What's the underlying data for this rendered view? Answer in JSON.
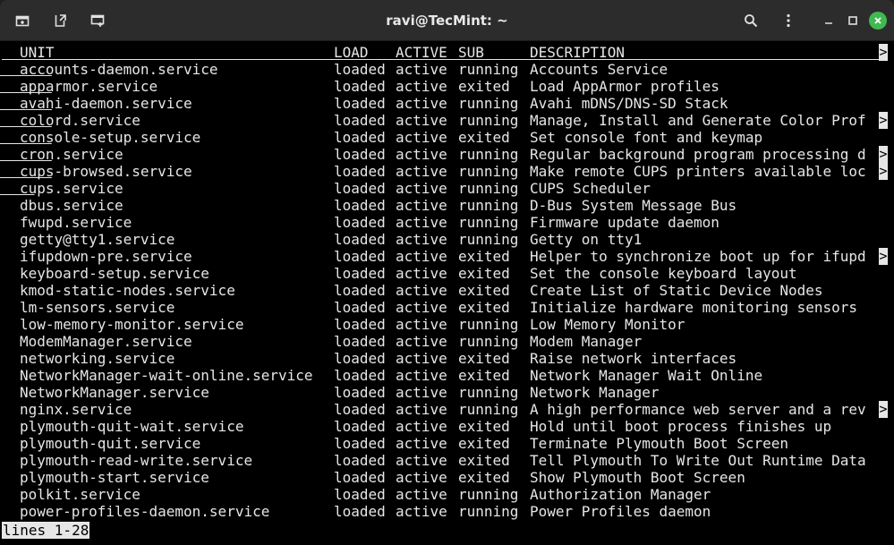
{
  "window": {
    "title": "ravi@TecMint: ~"
  },
  "icons": {
    "new_tab": "new-tab-icon",
    "detach_tab": "detach-tab-icon",
    "new_window": "new-window-icon",
    "search": "search-icon",
    "menu": "kebab-menu-icon",
    "minimize": "minimize-icon",
    "maximize": "maximize-icon",
    "close": "close-icon"
  },
  "colors": {
    "titlebar": "#2c2c2c",
    "terminal_bg": "#000000",
    "terminal_fg": "#e6e6e6",
    "close_button": "#3fb950"
  },
  "table": {
    "headers": {
      "unit": "UNIT",
      "load": "LOAD",
      "active": "ACTIVE",
      "sub": "SUB",
      "description": "DESCRIPTION"
    },
    "truncation_marker": ">",
    "rows": [
      {
        "unit": "accounts-daemon.service",
        "load": "loaded",
        "active": "active",
        "sub": "running",
        "description": "Accounts Service",
        "truncated": false
      },
      {
        "unit": "apparmor.service",
        "load": "loaded",
        "active": "active",
        "sub": "exited",
        "description": "Load AppArmor profiles",
        "truncated": false
      },
      {
        "unit": "avahi-daemon.service",
        "load": "loaded",
        "active": "active",
        "sub": "running",
        "description": "Avahi mDNS/DNS-SD Stack",
        "truncated": false
      },
      {
        "unit": "colord.service",
        "load": "loaded",
        "active": "active",
        "sub": "running",
        "description": "Manage, Install and Generate Color Prof",
        "truncated": true
      },
      {
        "unit": "console-setup.service",
        "load": "loaded",
        "active": "active",
        "sub": "exited",
        "description": "Set console font and keymap",
        "truncated": false
      },
      {
        "unit": "cron.service",
        "load": "loaded",
        "active": "active",
        "sub": "running",
        "description": "Regular background program processing d",
        "truncated": true
      },
      {
        "unit": "cups-browsed.service",
        "load": "loaded",
        "active": "active",
        "sub": "running",
        "description": "Make remote CUPS printers available loc",
        "truncated": true
      },
      {
        "unit": "cups.service",
        "load": "loaded",
        "active": "active",
        "sub": "running",
        "description": "CUPS Scheduler",
        "truncated": false
      },
      {
        "unit": "dbus.service",
        "load": "loaded",
        "active": "active",
        "sub": "running",
        "description": "D-Bus System Message Bus",
        "truncated": false
      },
      {
        "unit": "fwupd.service",
        "load": "loaded",
        "active": "active",
        "sub": "running",
        "description": "Firmware update daemon",
        "truncated": false
      },
      {
        "unit": "getty@tty1.service",
        "load": "loaded",
        "active": "active",
        "sub": "running",
        "description": "Getty on tty1",
        "truncated": false
      },
      {
        "unit": "ifupdown-pre.service",
        "load": "loaded",
        "active": "active",
        "sub": "exited",
        "description": "Helper to synchronize boot up for ifupd",
        "truncated": true
      },
      {
        "unit": "keyboard-setup.service",
        "load": "loaded",
        "active": "active",
        "sub": "exited",
        "description": "Set the console keyboard layout",
        "truncated": false
      },
      {
        "unit": "kmod-static-nodes.service",
        "load": "loaded",
        "active": "active",
        "sub": "exited",
        "description": "Create List of Static Device Nodes",
        "truncated": false
      },
      {
        "unit": "lm-sensors.service",
        "load": "loaded",
        "active": "active",
        "sub": "exited",
        "description": "Initialize hardware monitoring sensors",
        "truncated": false
      },
      {
        "unit": "low-memory-monitor.service",
        "load": "loaded",
        "active": "active",
        "sub": "running",
        "description": "Low Memory Monitor",
        "truncated": false
      },
      {
        "unit": "ModemManager.service",
        "load": "loaded",
        "active": "active",
        "sub": "running",
        "description": "Modem Manager",
        "truncated": false
      },
      {
        "unit": "networking.service",
        "load": "loaded",
        "active": "active",
        "sub": "exited",
        "description": "Raise network interfaces",
        "truncated": false
      },
      {
        "unit": "NetworkManager-wait-online.service",
        "load": "loaded",
        "active": "active",
        "sub": "exited",
        "description": "Network Manager Wait Online",
        "truncated": false
      },
      {
        "unit": "NetworkManager.service",
        "load": "loaded",
        "active": "active",
        "sub": "running",
        "description": "Network Manager",
        "truncated": false
      },
      {
        "unit": "nginx.service",
        "load": "loaded",
        "active": "active",
        "sub": "running",
        "description": "A high performance web server and a rev",
        "truncated": true
      },
      {
        "unit": "plymouth-quit-wait.service",
        "load": "loaded",
        "active": "active",
        "sub": "exited",
        "description": "Hold until boot process finishes up",
        "truncated": false
      },
      {
        "unit": "plymouth-quit.service",
        "load": "loaded",
        "active": "active",
        "sub": "exited",
        "description": "Terminate Plymouth Boot Screen",
        "truncated": false
      },
      {
        "unit": "plymouth-read-write.service",
        "load": "loaded",
        "active": "active",
        "sub": "exited",
        "description": "Tell Plymouth To Write Out Runtime Data",
        "truncated": false
      },
      {
        "unit": "plymouth-start.service",
        "load": "loaded",
        "active": "active",
        "sub": "exited",
        "description": "Show Plymouth Boot Screen",
        "truncated": false
      },
      {
        "unit": "polkit.service",
        "load": "loaded",
        "active": "active",
        "sub": "running",
        "description": "Authorization Manager",
        "truncated": false
      },
      {
        "unit": "power-profiles-daemon.service",
        "load": "loaded",
        "active": "active",
        "sub": "running",
        "description": "Power Profiles daemon",
        "truncated": false
      }
    ]
  },
  "pager": {
    "status": "lines 1-28"
  }
}
